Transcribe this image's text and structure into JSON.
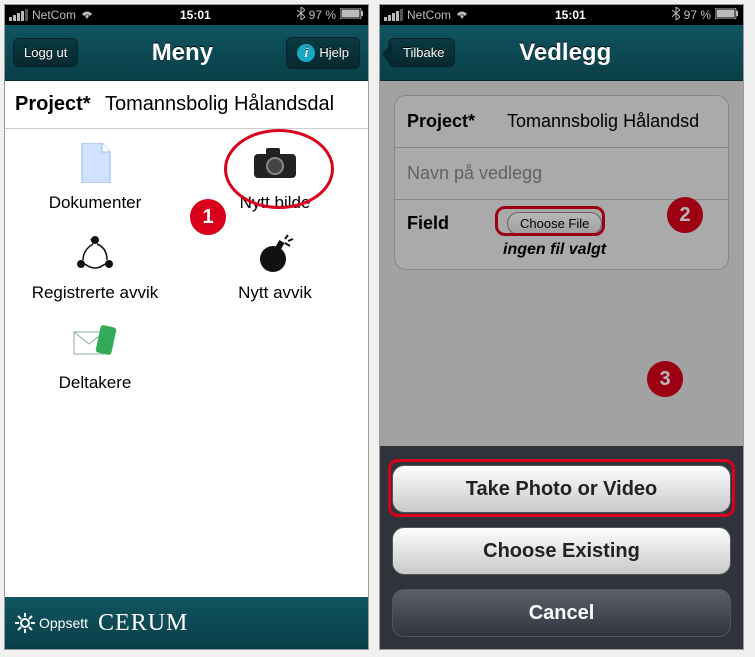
{
  "statusbar": {
    "carrier": "NetCom",
    "time": "15:01",
    "battery": "97 %"
  },
  "screen1": {
    "nav": {
      "logout": "Logg ut",
      "title": "Meny",
      "help": "Hjelp"
    },
    "project_label": "Project*",
    "project_value": "Tomannsbolig Hålandsdal",
    "icons": {
      "documents": "Dokumenter",
      "new_photo": "Nytt bilde",
      "reg_deviation": "Registrerte avvik",
      "new_deviation": "Nytt avvik",
      "participants": "Deltakere"
    },
    "bottom": {
      "settings": "Oppsett",
      "brand": "CERUM"
    },
    "annotations": {
      "step": "1"
    }
  },
  "screen2": {
    "nav": {
      "back": "Tilbake",
      "title": "Vedlegg"
    },
    "project_label": "Project*",
    "project_value": "Tomannsbolig Hålandsd",
    "name_placeholder": "Navn på vedlegg",
    "field_label": "Field",
    "choose_file": "Choose File",
    "no_file": "ingen fil valgt",
    "sheet": {
      "take": "Take Photo or Video",
      "choose": "Choose Existing",
      "cancel": "Cancel"
    },
    "annotations": {
      "step2": "2",
      "step3": "3"
    }
  }
}
